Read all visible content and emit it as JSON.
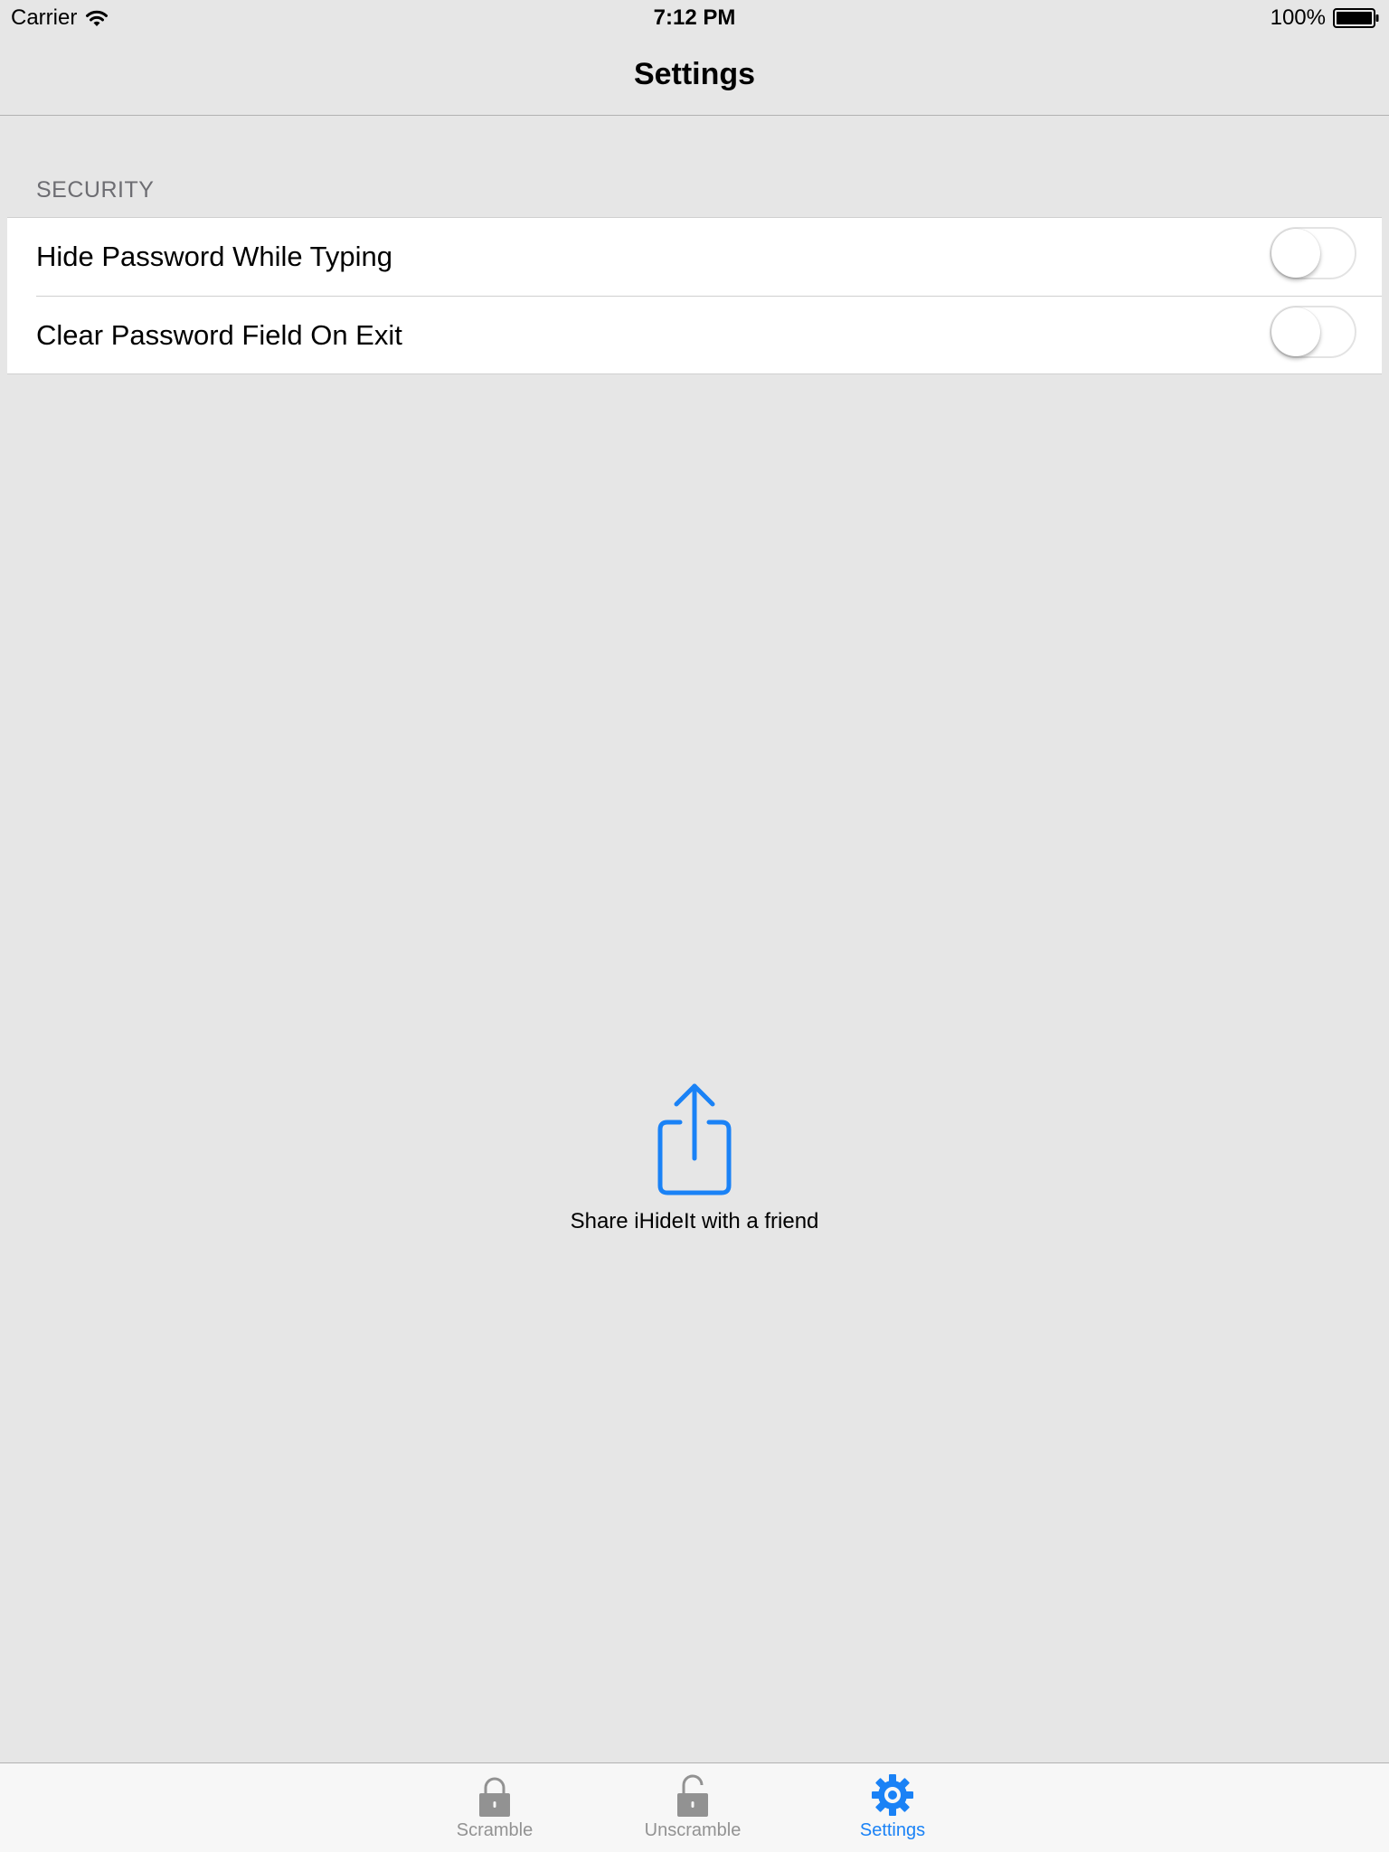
{
  "status_bar": {
    "carrier": "Carrier",
    "time": "7:12 PM",
    "battery": "100%",
    "wifi_icon": "wifi-icon",
    "battery_icon": "battery-icon"
  },
  "nav": {
    "title": "Settings"
  },
  "security": {
    "header": "SECURITY",
    "rows": [
      {
        "label": "Hide Password While Typing",
        "on": false
      },
      {
        "label": "Clear Password Field On Exit",
        "on": false
      }
    ]
  },
  "share": {
    "label": "Share iHideIt with a friend",
    "icon": "share-icon"
  },
  "tabs": [
    {
      "label": "Scramble",
      "icon": "lock-closed-icon",
      "selected": false
    },
    {
      "label": "Unscramble",
      "icon": "lock-open-icon",
      "selected": false
    },
    {
      "label": "Settings",
      "icon": "gear-icon",
      "selected": true
    }
  ],
  "colors": {
    "accent": "#1a82f6",
    "inactive_tab": "#929292",
    "background": "#e6e6e6"
  }
}
